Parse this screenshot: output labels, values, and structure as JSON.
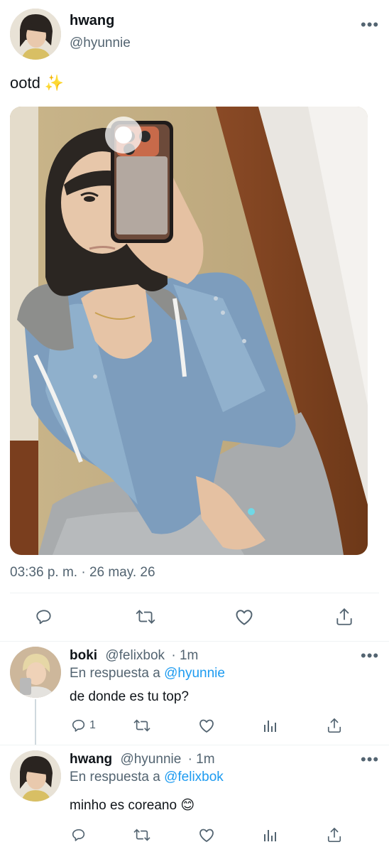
{
  "tweet": {
    "author_name": "hwang",
    "author_handle": "@hyunnie",
    "text": "ootd ✨",
    "timestamp": "03:36 p. m. · 26 may. 26",
    "more_icon": "more-icon"
  },
  "actions": {
    "reply_icon": "reply-icon",
    "retweet_icon": "retweet-icon",
    "like_icon": "like-icon",
    "share_icon": "share-icon"
  },
  "replies": [
    {
      "author_name": "boki",
      "author_handle": "@felixbok",
      "time": "· 1m",
      "reply_prefix": "En respuesta a",
      "reply_to": "@hyunnie",
      "text": "de donde es tu top?",
      "reply_count": "1"
    },
    {
      "author_name": "hwang",
      "author_handle": "@hyunnie",
      "time": "· 1m",
      "reply_prefix": "En respuesta a",
      "reply_to": "@felixbok",
      "text": "minho es coreano 😊",
      "reply_count": ""
    }
  ],
  "colors": {
    "link": "#1d9bf0",
    "muted": "#536471",
    "text": "#0f1419"
  }
}
